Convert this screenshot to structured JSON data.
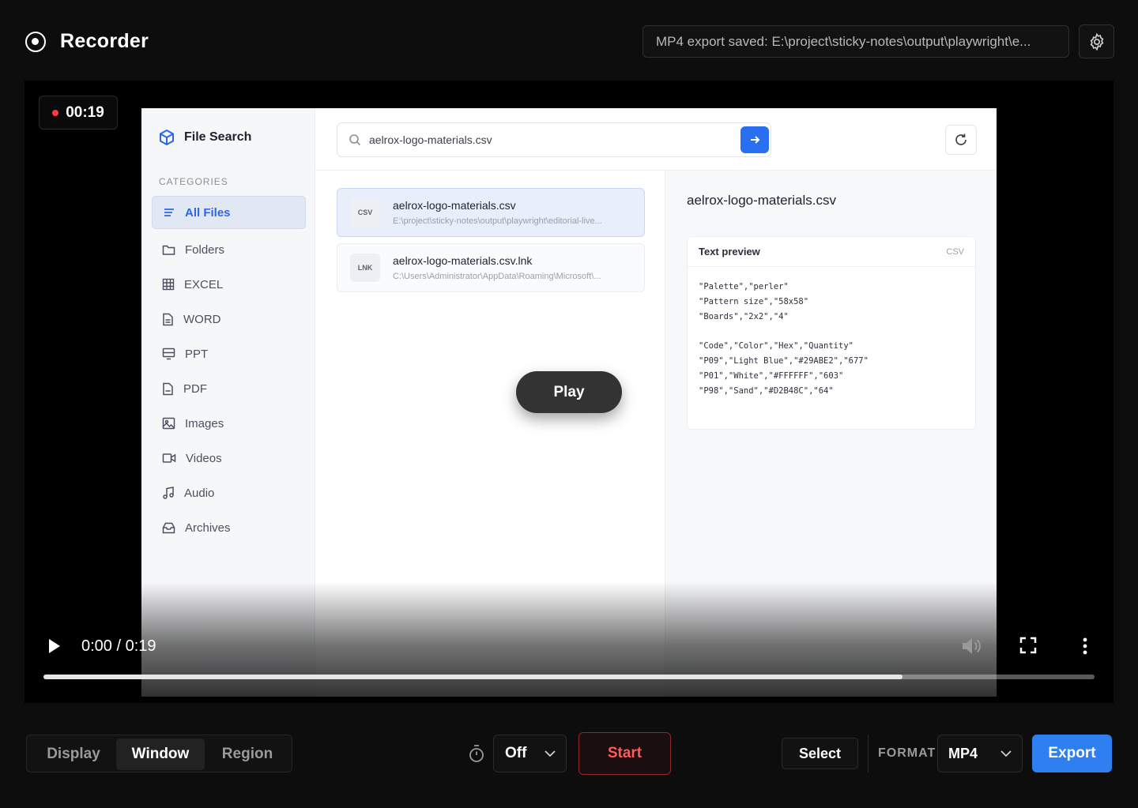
{
  "header": {
    "title": "Recorder",
    "status": "MP4 export saved: E:\\project\\sticky-notes\\output\\playwright\\e..."
  },
  "video": {
    "elapsed": "00:19",
    "overlay_play": "Play",
    "time_display": "0:00 / 0:19",
    "progress_fraction": 0.817
  },
  "app": {
    "title": "File Search",
    "categories_label": "CATEGORIES",
    "nav": [
      {
        "label": "All Files",
        "icon": "list-icon"
      },
      {
        "label": "Folders",
        "icon": "folder-icon"
      },
      {
        "label": "EXCEL",
        "icon": "grid-icon"
      },
      {
        "label": "WORD",
        "icon": "document-icon"
      },
      {
        "label": "PPT",
        "icon": "slides-icon"
      },
      {
        "label": "PDF",
        "icon": "pdf-icon"
      },
      {
        "label": "Images",
        "icon": "image-icon"
      },
      {
        "label": "Videos",
        "icon": "video-icon"
      },
      {
        "label": "Audio",
        "icon": "music-icon"
      },
      {
        "label": "Archives",
        "icon": "archive-icon"
      }
    ],
    "search_value": "aelrox-logo-materials.csv",
    "results": [
      {
        "type": "CSV",
        "name": "aelrox-logo-materials.csv",
        "path": "E:\\project\\sticky-notes\\output\\playwright\\editorial-live..."
      },
      {
        "type": "LNK",
        "name": "aelrox-logo-materials.csv.lnk",
        "path": "C:\\Users\\Administrator\\AppData\\Roaming\\Microsoft\\..."
      }
    ],
    "preview": {
      "title": "aelrox-logo-materials.csv",
      "card_title": "Text preview",
      "card_type": "CSV",
      "content": "\"Palette\",\"perler\"\n\"Pattern size\",\"58x58\"\n\"Boards\",\"2x2\",\"4\"\n\n\"Code\",\"Color\",\"Hex\",\"Quantity\"\n\"P09\",\"Light Blue\",\"#29ABE2\",\"677\"\n\"P01\",\"White\",\"#FFFFFF\",\"603\"\n\"P98\",\"Sand\",\"#D2B48C\",\"64\""
    }
  },
  "toolbar": {
    "modes": [
      "Display",
      "Window",
      "Region"
    ],
    "active_mode": "Window",
    "timer_value": "Off",
    "start_label": "Start",
    "select_label": "Select",
    "format_label": "FORMAT",
    "format_value": "MP4",
    "export_label": "Export"
  },
  "colors": {
    "accent": "#2f7ff0",
    "record": "#ff3b3b",
    "start_text": "#ff5a5a"
  }
}
